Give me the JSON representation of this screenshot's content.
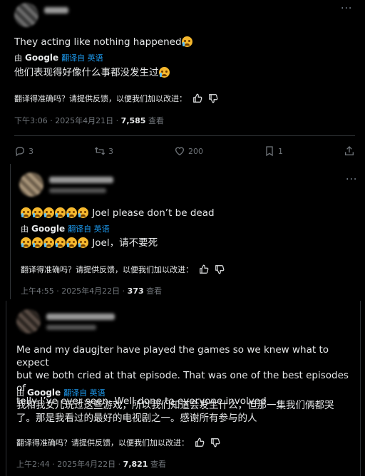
{
  "ui": {
    "translated_by": "由",
    "google": "Google",
    "translated_from": "翻译自 英语",
    "feedback_prompt": "翻译得准确吗？请提供反馈，以便我们加以改进：",
    "views_label": "查看",
    "more": "···"
  },
  "icons": {
    "reply": "reply-icon",
    "retweet": "retweet-icon",
    "like": "heart-icon",
    "bookmark": "bookmark-icon",
    "share": "share-icon",
    "thumb_up": "thumb-up-icon",
    "thumb_down": "thumb-down-icon"
  },
  "posts": [
    {
      "text": "They acting like nothing happened",
      "emoji_count_text": 1,
      "translation": "他们表现得好像什么事都没发生过",
      "emoji_count_translation": 1,
      "time": "下午3:06 · 2025年4月21日 · ",
      "views": "7,585",
      "stats": {
        "replies": "3",
        "retweets": "3",
        "likes": "200",
        "bookmarks": "1"
      }
    },
    {
      "text": "Joel please don’t be dead",
      "emoji_count_text": 6,
      "translation": "Joel，请不要死",
      "emoji_count_translation": 6,
      "time": "上午4:55 · 2025年4月22日 · ",
      "views": "373"
    },
    {
      "text_lines": [
        "Me and my daugjter have played the games so we knew what to expect",
        "but we both cried at that episode. That was one of the best episodes of",
        "telly I’ve ever seen. Well done to everyone involved"
      ],
      "translation_lines": [
        "我和我女儿玩过这些游戏，所以我们知道会发生什么，但那一集我们俩都哭",
        "了。那是我看过的最好的电视剧之一。感谢所有参与的人"
      ],
      "time": "上午2:44 · 2025年4月22日 · ",
      "views": "7,821"
    }
  ]
}
